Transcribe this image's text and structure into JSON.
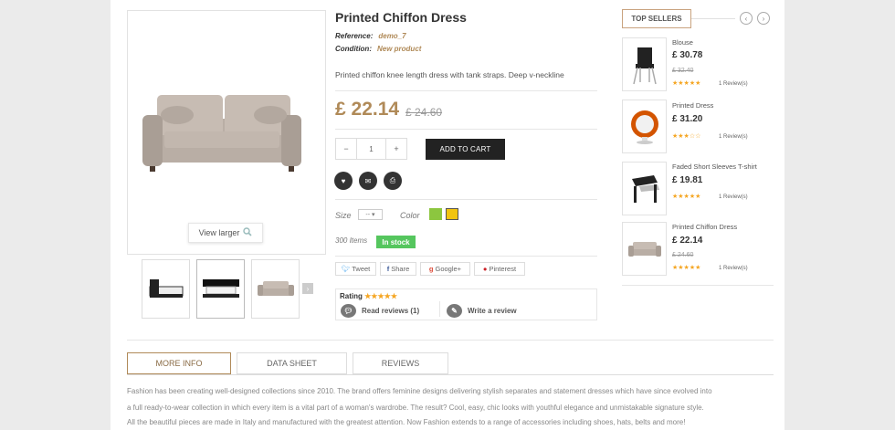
{
  "product": {
    "title": "Printed Chiffon Dress",
    "reference_label": "Reference:",
    "reference_value": "demo_7",
    "condition_label": "Condition:",
    "condition_value": "New product",
    "description": "Printed chiffon knee length dress with tank straps. Deep v-neckline",
    "price": "£ 22.14",
    "old_price": "£ 24.60",
    "quantity": "1",
    "add_to_cart": "ADD TO CART",
    "size_label": "Size",
    "size_value": "--",
    "color_label": "Color",
    "colors": [
      "#8cc63f",
      "#f1c40f"
    ],
    "items_count": "300 Items",
    "stock_status": "In stock",
    "view_larger": "View larger"
  },
  "share": {
    "tweet": "Tweet",
    "share": "Share",
    "google": "Google+",
    "pinterest": "Pinterest"
  },
  "reviews": {
    "rating_label": "Rating",
    "rating_stars": "★★★★★",
    "read_reviews": "Read reviews (1)",
    "write_review": "Write a review"
  },
  "top_sellers": {
    "title": "TOP SELLERS",
    "prev": "‹",
    "next": "›",
    "items": [
      {
        "name": "Blouse",
        "price": "£ 30.78",
        "old_price": "£ 32.40",
        "stars": "★★★★★",
        "reviews": "1 Review(s)"
      },
      {
        "name": "Printed Dress",
        "price": "£ 31.20",
        "old_price": "",
        "stars": "★★★☆☆",
        "reviews": "1 Review(s)"
      },
      {
        "name": "Faded Short Sleeves T-shirt",
        "price": "£ 19.81",
        "old_price": "",
        "stars": "★★★★★",
        "reviews": "1 Review(s)"
      },
      {
        "name": "Printed Chiffon Dress",
        "price": "£ 22.14",
        "old_price": "£ 24.60",
        "stars": "★★★★★",
        "reviews": "1 Review(s)"
      }
    ]
  },
  "tabs": [
    "MORE INFO",
    "DATA SHEET",
    "REVIEWS"
  ],
  "more_info": {
    "line1": "Fashion has been creating well-designed collections since 2010. The brand offers feminine designs delivering stylish separates and statement dresses which have since evolved into",
    "line2": "a full ready-to-wear collection in which every item is a vital part of a woman's wardrobe. The result? Cool, easy, chic looks with youthful elegance and unmistakable signature style.",
    "line3": "All the beautiful pieces are made in Italy and manufactured with the greatest attention. Now Fashion extends to a range of accessories including shoes, hats, belts and more!"
  }
}
